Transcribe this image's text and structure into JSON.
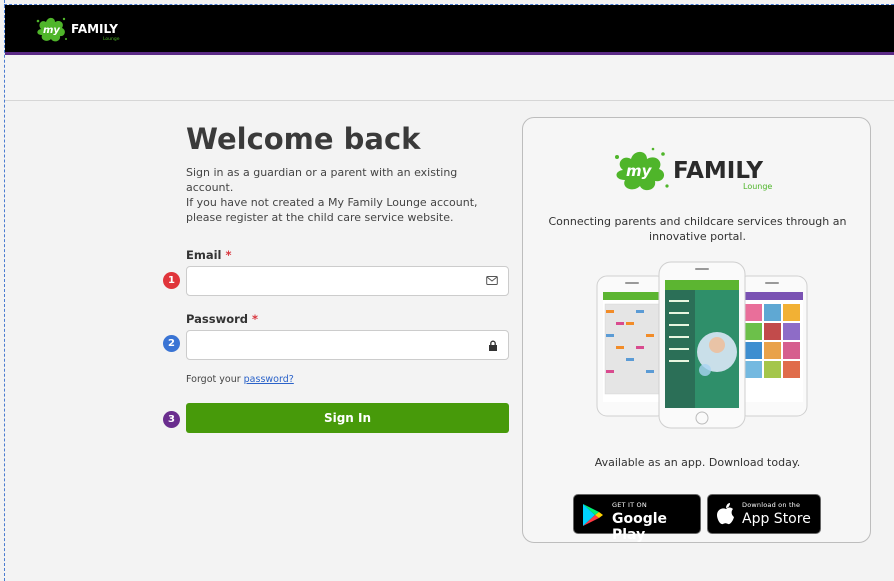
{
  "header": {
    "logo_my": "my",
    "logo_family": "FAMILY",
    "logo_lounge": "Lounge"
  },
  "login": {
    "title": "Welcome back",
    "intro_line1": "Sign in as a guardian or a parent with an existing account.",
    "intro_line2": "If you have not created a My Family Lounge account, please register at the child care service website.",
    "email_label": "Email",
    "password_label": "Password",
    "required_mark": "*",
    "email_value": "",
    "password_value": "",
    "forgot_prefix": "Forgot your ",
    "forgot_link": "password?",
    "signin_label": "Sign In"
  },
  "annotations": {
    "step1": "1",
    "step2": "2",
    "step3": "3",
    "color1": "#e0353b",
    "color2": "#3a74d4",
    "color3": "#6a2d8e"
  },
  "promo": {
    "tagline": "Connecting parents and childcare services through an innovative portal.",
    "available": "Available as an app. Download today.",
    "google_small": "GET IT ON",
    "google_big": "Google Play",
    "apple_small": "Download on the",
    "apple_big": "App Store"
  },
  "colors": {
    "brand_green": "#4fb52a",
    "signin_green": "#479a0a",
    "header_purple": "#5b2a86"
  }
}
